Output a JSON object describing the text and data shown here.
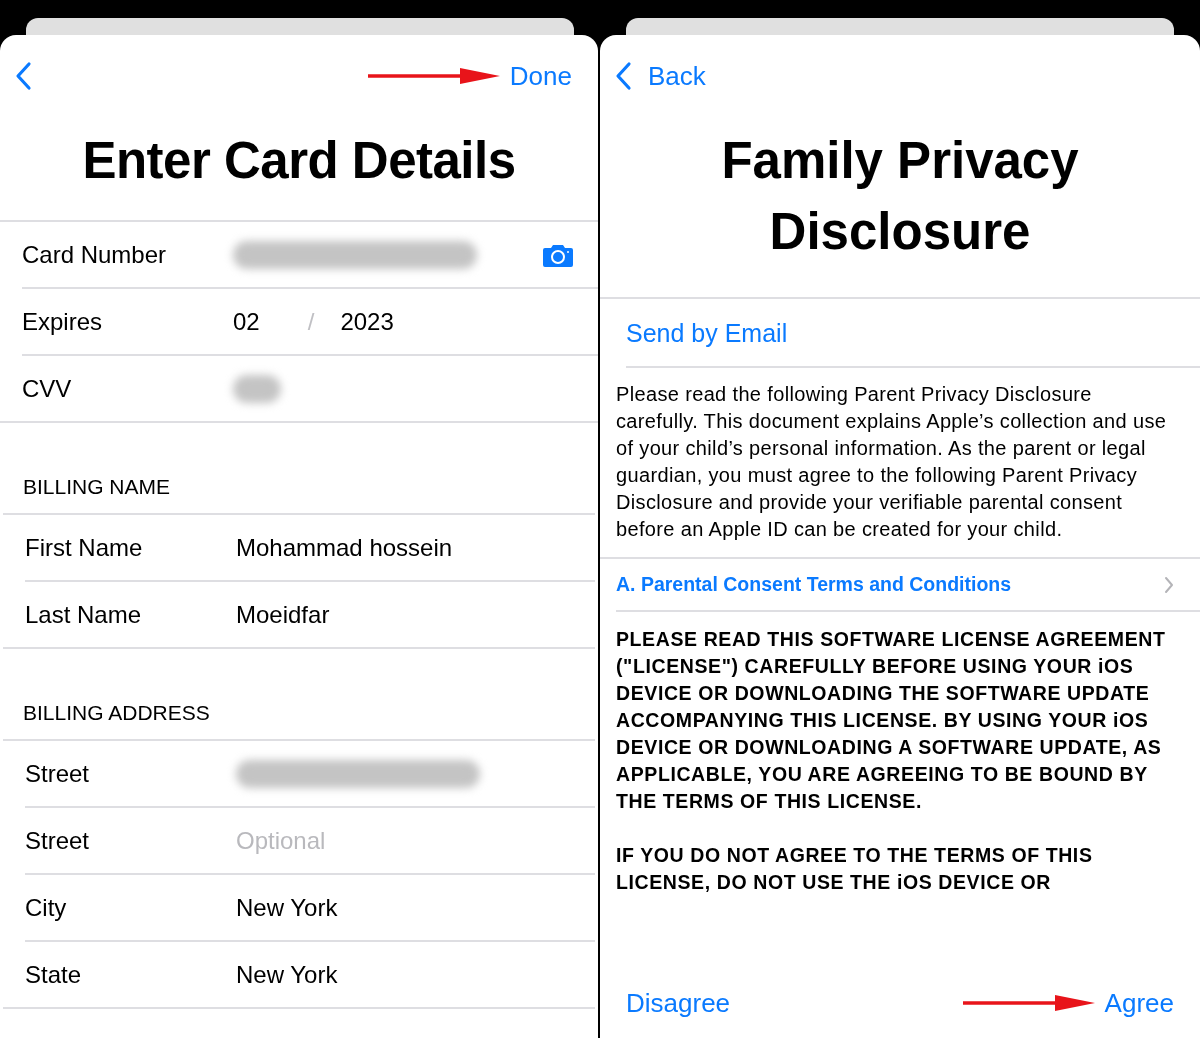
{
  "card_screen": {
    "nav": {
      "done": "Done"
    },
    "title": "Enter Card Details",
    "sections": [
      {
        "rows": [
          {
            "label": "Card Number",
            "kind": "masked",
            "has_camera": true
          },
          {
            "label": "Expires",
            "kind": "expiry",
            "month": "02",
            "separator": "/",
            "year": "2023"
          },
          {
            "label": "CVV",
            "kind": "masked_short"
          }
        ]
      },
      {
        "header": "BILLING NAME",
        "rows": [
          {
            "label": "First Name",
            "kind": "value",
            "value": "Mohammad hossein"
          },
          {
            "label": "Last Name",
            "kind": "value",
            "value": "Moeidfar"
          }
        ]
      },
      {
        "header": "BILLING ADDRESS",
        "rows": [
          {
            "label": "Street",
            "kind": "masked"
          },
          {
            "label": "Street",
            "kind": "placeholder",
            "placeholder": "Optional"
          },
          {
            "label": "City",
            "kind": "value",
            "value": "New York"
          },
          {
            "label": "State",
            "kind": "value",
            "value": "New York"
          }
        ]
      }
    ]
  },
  "disclosure_screen": {
    "nav": {
      "back": "Back"
    },
    "title": "Family Privacy Disclosure",
    "send_link": "Send by Email",
    "intro": "Please read the following Parent Privacy Disclosure carefully. This document explains Apple’s collection and use of your child’s personal information. As the parent or legal guardian, you must agree to the following Parent Privacy Disclosure and provide your verifiable parental consent before an Apple ID can be created for your child.",
    "section_link": "A. Parental Consent Terms and Conditions",
    "license": [
      "PLEASE READ THIS SOFTWARE LICENSE AGREEMENT (\"LICENSE\") CAREFULLY BEFORE USING YOUR iOS DEVICE OR DOWNLOADING THE SOFTWARE UPDATE ACCOMPANYING THIS LICENSE. BY USING YOUR iOS DEVICE OR DOWNLOADING A SOFTWARE UPDATE, AS APPLICABLE, YOU ARE AGREEING TO BE BOUND BY THE TERMS OF THIS LICENSE.",
      "IF YOU DO NOT AGREE TO THE TERMS OF THIS LICENSE, DO NOT USE THE iOS DEVICE OR"
    ],
    "footer": {
      "disagree": "Disagree",
      "agree": "Agree"
    }
  }
}
